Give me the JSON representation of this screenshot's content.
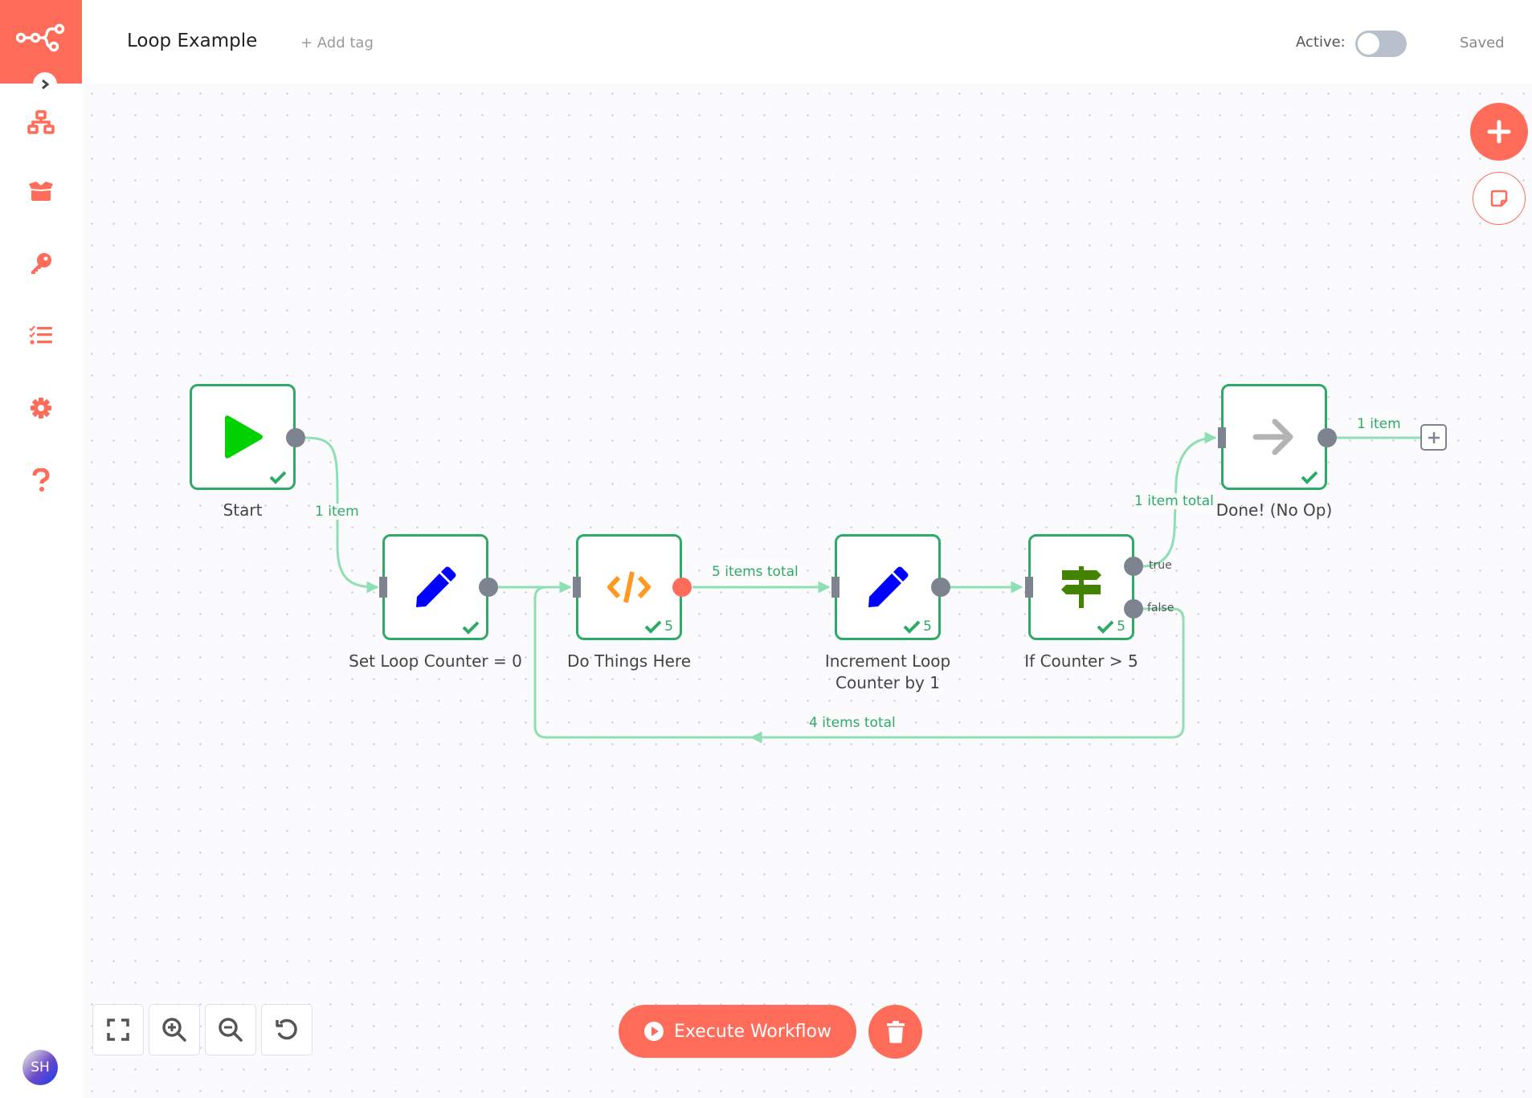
{
  "header": {
    "workflow_title": "Loop Example",
    "add_tag": "+ Add tag",
    "active_label": "Active:",
    "active": false,
    "save_status": "Saved"
  },
  "sidebar": {
    "items": [
      {
        "icon": "network-icon",
        "label": "Workflows"
      },
      {
        "icon": "box-open-icon",
        "label": "Templates"
      },
      {
        "icon": "key-icon",
        "label": "Credentials"
      },
      {
        "icon": "tasks-icon",
        "label": "Executions"
      },
      {
        "icon": "cog-icon",
        "label": "Settings"
      },
      {
        "icon": "question-icon",
        "label": "Help"
      }
    ],
    "user_initials": "SH"
  },
  "colors": {
    "brand": "#ff6d5a",
    "success": "#2daa68",
    "edge": "#8fdfb4",
    "port": "#7d838f"
  },
  "nodes": [
    {
      "id": "start",
      "name": "Start",
      "icon": "play-icon",
      "status_count": ""
    },
    {
      "id": "set-counter",
      "name": "Set Loop Counter = 0",
      "icon": "pen-icon",
      "status_count": ""
    },
    {
      "id": "do-things",
      "name": "Do Things Here",
      "icon": "code-icon",
      "status_count": "5"
    },
    {
      "id": "increment",
      "name_line1": "Increment Loop",
      "name_line2": "Counter by 1",
      "icon": "pen-icon",
      "status_count": "5"
    },
    {
      "id": "if-counter",
      "name": "If Counter > 5",
      "icon": "signpost-icon",
      "status_count": "5",
      "outputs": [
        "true",
        "false"
      ]
    },
    {
      "id": "done",
      "name": "Done! (No Op)",
      "icon": "arrow-right-icon",
      "status_count": ""
    }
  ],
  "edges": [
    {
      "from": "Start",
      "to": "Set Loop Counter = 0",
      "label": "1 item"
    },
    {
      "from": "Set Loop Counter = 0",
      "to": "Do Things Here",
      "label": ""
    },
    {
      "from": "Do Things Here",
      "to": "Increment Loop Counter by 1",
      "label": "5 items total"
    },
    {
      "from": "Increment Loop Counter by 1",
      "to": "If Counter > 5",
      "label": ""
    },
    {
      "from": "If Counter > 5 (true)",
      "to": "Done! (No Op)",
      "label": "1 item total"
    },
    {
      "from": "If Counter > 5 (false)",
      "to": "Do Things Here",
      "label": "4 items total"
    },
    {
      "from": "Done! (No Op)",
      "to": "",
      "label": "1 item"
    }
  ],
  "footer": {
    "execute_label": "Execute Workflow",
    "zoom_controls": [
      "zoom-to-fit",
      "zoom-in",
      "zoom-out",
      "reset-zoom"
    ]
  }
}
